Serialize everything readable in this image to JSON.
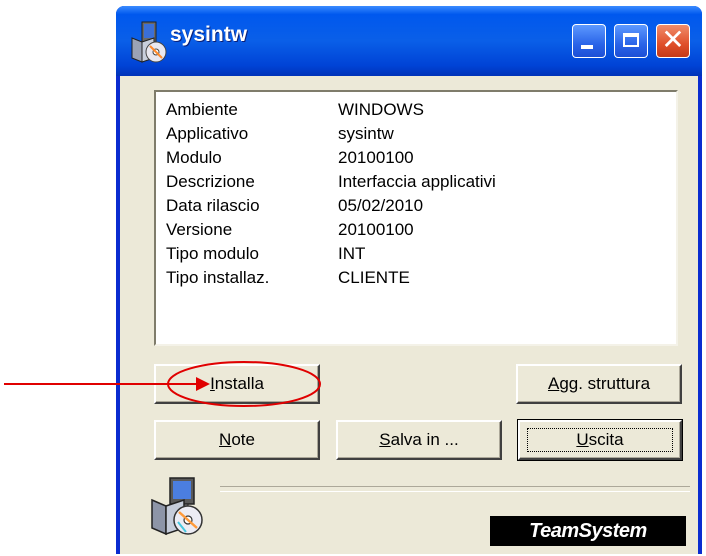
{
  "window": {
    "title": "sysintw",
    "title_icon": "setup-package-icon",
    "controls": [
      "minimize-icon",
      "maximize-icon",
      "close-icon"
    ],
    "close_glyph": "✕"
  },
  "info": [
    {
      "label": "Ambiente",
      "value": "WINDOWS"
    },
    {
      "label": "Applicativo",
      "value": "sysintw"
    },
    {
      "label": "Modulo",
      "value": "20100100"
    },
    {
      "label": "Descrizione",
      "value": "Interfaccia applicativi"
    },
    {
      "label": "Data rilascio",
      "value": "05/02/2010"
    },
    {
      "label": "Versione",
      "value": "20100100"
    },
    {
      "label": "Tipo modulo",
      "value": "INT"
    },
    {
      "label": "Tipo installaz.",
      "value": "CLIENTE"
    }
  ],
  "buttons": {
    "installa": {
      "mnemonic": "I",
      "rest": "nstalla"
    },
    "agg_struttura": {
      "mnemonic": "A",
      "rest": "gg. struttura"
    },
    "note": {
      "mnemonic": "N",
      "rest": "ote"
    },
    "salva_in": {
      "mnemonic": "S",
      "rest": "alva in ..."
    },
    "uscita": {
      "mnemonic": "U",
      "rest": "scita"
    }
  },
  "footer": {
    "brand": "TeamSystem",
    "setup_icon": "setup-cd-icon"
  },
  "annotation": {
    "arrow_color": "#e00000",
    "ellipse_color": "#e00000"
  }
}
